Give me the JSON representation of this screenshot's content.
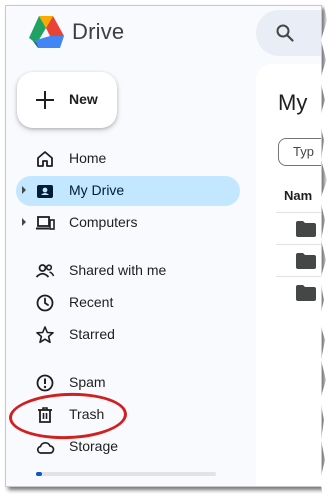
{
  "app": {
    "brand": "Drive"
  },
  "new_button": {
    "label": "New"
  },
  "sidebar": {
    "items": [
      {
        "label": "Home",
        "icon": "home-icon",
        "active": false
      },
      {
        "label": "My Drive",
        "icon": "my-drive-icon",
        "active": true
      },
      {
        "label": "Computers",
        "icon": "computers-icon",
        "active": false
      },
      {
        "label": "Shared with me",
        "icon": "shared-icon",
        "active": false
      },
      {
        "label": "Recent",
        "icon": "clock-icon",
        "active": false
      },
      {
        "label": "Starred",
        "icon": "star-icon",
        "active": false
      },
      {
        "label": "Spam",
        "icon": "spam-icon",
        "active": false
      },
      {
        "label": "Trash",
        "icon": "trash-icon",
        "active": false
      },
      {
        "label": "Storage",
        "icon": "cloud-icon",
        "active": false
      }
    ]
  },
  "main": {
    "title": "My",
    "type_chip": "Typ",
    "column_header": "Nam",
    "rows": [
      "folder",
      "folder",
      "folder"
    ]
  },
  "colors": {
    "active_bg": "#c2e7ff",
    "annotation": "#d21f1f",
    "search_bg": "#e9eef6"
  }
}
